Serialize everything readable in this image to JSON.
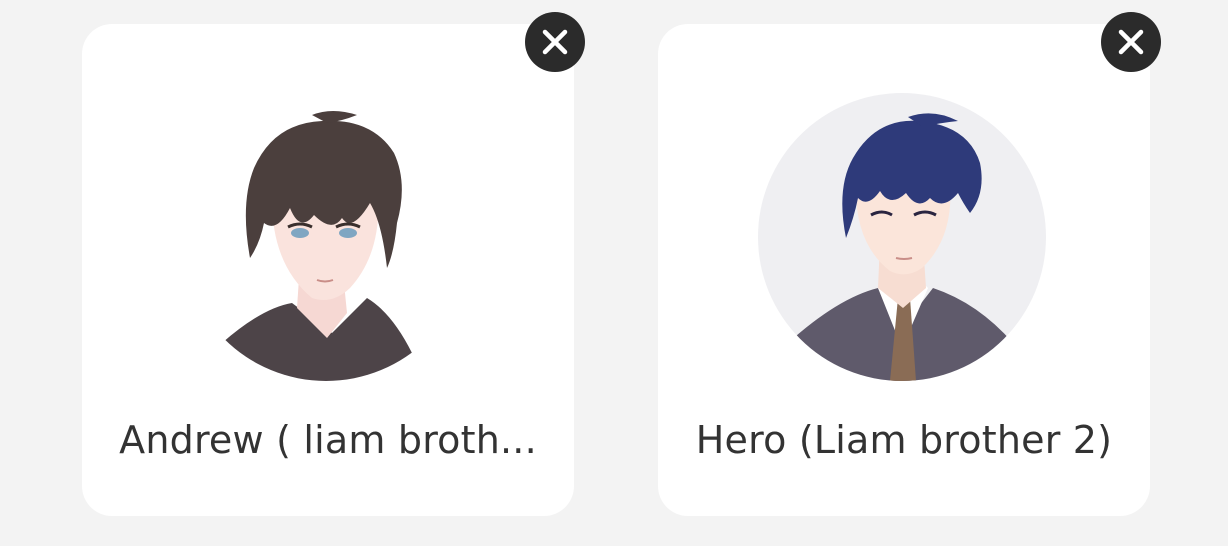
{
  "characters": [
    {
      "name": "Andrew ( liam broth...",
      "avatar_icon": "anime-man-brown-hair-avatar",
      "remove_icon": "close-icon"
    },
    {
      "name": "Hero (Liam brother 2)",
      "avatar_icon": "anime-man-blue-hair-suit-avatar",
      "remove_icon": "close-icon"
    }
  ],
  "colors": {
    "background": "#f3f3f3",
    "card": "#ffffff",
    "close_button": "#2b2b2b",
    "text": "#333333"
  }
}
